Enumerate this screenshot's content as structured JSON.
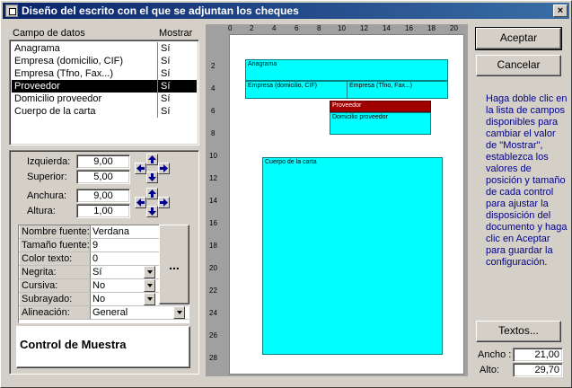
{
  "window": {
    "title": "Diseño del escrito con el que se adjuntan los cheques",
    "close_label": "×"
  },
  "list": {
    "col_field": "Campo de datos",
    "col_show": "Mostrar",
    "rows": [
      {
        "name": "Anagrama",
        "show": "Sí"
      },
      {
        "name": "Empresa (domicilio, CIF)",
        "show": "Sí"
      },
      {
        "name": "Empresa (Tfno, Fax...)",
        "show": "Sí"
      },
      {
        "name": "Proveedor",
        "show": "Sí",
        "selected": true
      },
      {
        "name": "Domicilio proveedor",
        "show": "Sí"
      },
      {
        "name": "Cuerpo de la carta",
        "show": "Sí"
      }
    ]
  },
  "position": {
    "left_label": "Izquierda:",
    "left_value": "9,00",
    "top_label": "Superior:",
    "top_value": "5,00",
    "width_label": "Anchura:",
    "width_value": "9,00",
    "height_label": "Altura:",
    "height_value": "1,00"
  },
  "font": {
    "rows": [
      {
        "key": "Nombre fuente:",
        "value": "Verdana",
        "dropdown": false
      },
      {
        "key": "Tamaño fuente:",
        "value": "9",
        "dropdown": false
      },
      {
        "key": "Color texto:",
        "value": "0",
        "dropdown": false
      },
      {
        "key": "Negrita:",
        "value": "Sí",
        "dropdown": true
      },
      {
        "key": "Cursiva:",
        "value": "No",
        "dropdown": true
      },
      {
        "key": "Subrayado:",
        "value": "No",
        "dropdown": true
      },
      {
        "key": "Alineación:",
        "value": "General",
        "dropdown": true
      }
    ],
    "ellipsis_label": "..."
  },
  "sample": {
    "label": "Control de Muestra"
  },
  "preview": {
    "ruler_top": [
      "0",
      "2",
      "4",
      "6",
      "8",
      "10",
      "12",
      "14",
      "16",
      "18",
      "20"
    ],
    "ruler_left": [
      "2",
      "4",
      "6",
      "8",
      "10",
      "12",
      "14",
      "16",
      "18",
      "20",
      "22",
      "24",
      "26",
      "28"
    ],
    "boxes": [
      {
        "id": "anagrama",
        "label": "Anagrama"
      },
      {
        "id": "empresa-domicilio",
        "label": "Empresa (domicilio, CIF)"
      },
      {
        "id": "empresa-tfno",
        "label": "Empresa (Tfno, Fax...)"
      },
      {
        "id": "proveedor",
        "label": "Proveedor"
      },
      {
        "id": "domicilio-proveedor",
        "label": "Domicilio proveedor"
      },
      {
        "id": "cuerpo",
        "label": "Cuerpo de la carta"
      }
    ]
  },
  "buttons": {
    "accept": "Aceptar",
    "cancel": "Cancelar",
    "texts": "Textos..."
  },
  "hint": "Haga doble clic en la lista de campos disponibles para cambiar el valor de \"Mostrar\", establezca los valores de posición y tamaño de cada control para ajustar la disposición del documento y haga clic en Aceptar para guardar la configuración.",
  "dimensions": {
    "width_label": "Ancho :",
    "width_value": "21,00",
    "height_label": "Alto:",
    "height_value": "29,70"
  },
  "colors": {
    "titlebar": "#0a246a",
    "box_fill": "#00ffff",
    "box_selected": "#a00000",
    "hint_text": "#00008b"
  }
}
